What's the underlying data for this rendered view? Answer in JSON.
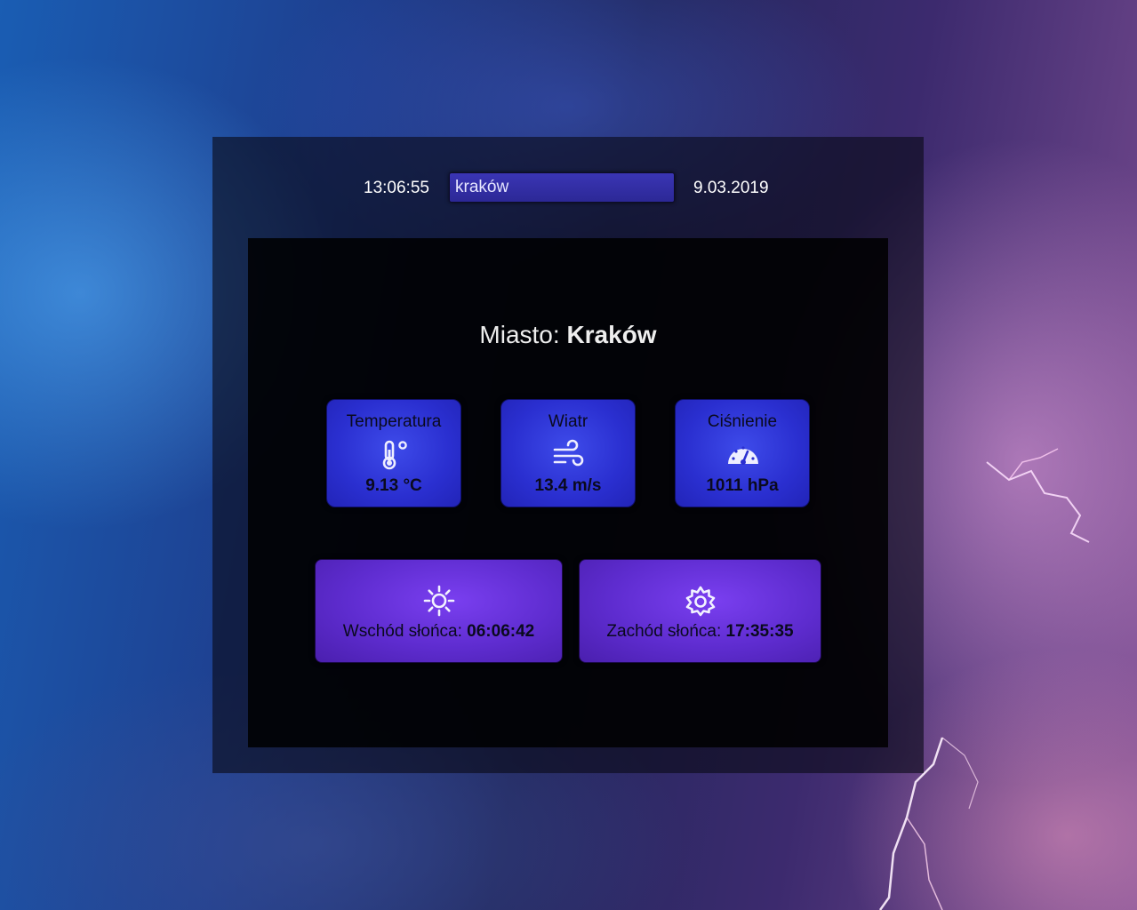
{
  "header": {
    "time": "13:06:55",
    "search_value": "kraków",
    "date": "9.03.2019"
  },
  "city": {
    "prefix": "Miasto:",
    "name": "Kraków"
  },
  "cards": [
    {
      "label": "Temperatura",
      "icon": "thermometer-icon",
      "value": "9.13 °C"
    },
    {
      "label": "Wiatr",
      "icon": "wind-icon",
      "value": "13.4 m/s"
    },
    {
      "label": "Ciśnienie",
      "icon": "gauge-icon",
      "value": "1011 hPa"
    }
  ],
  "sun": {
    "sunrise_label": "Wschód słońca:",
    "sunrise_time": "06:06:42",
    "sunrise_icon": "sun-icon",
    "sunset_label": "Zachód słońca:",
    "sunset_time": "17:35:35",
    "sunset_icon": "sunset-icon"
  },
  "colors": {
    "card_blue": "#2a2fd0",
    "card_purple": "#5e2ccf",
    "search_bg": "#3a35b4"
  }
}
